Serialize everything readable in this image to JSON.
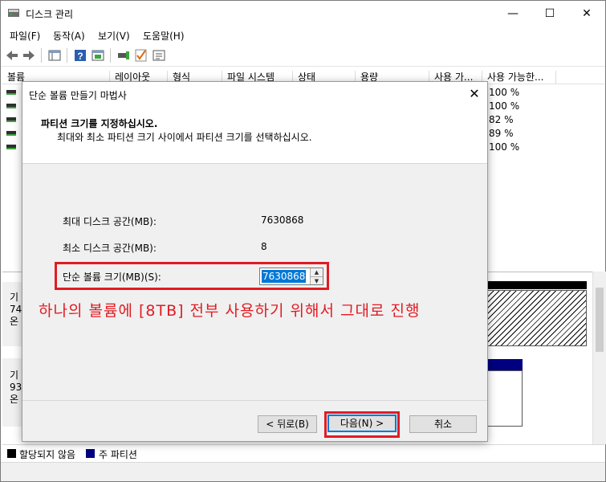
{
  "window": {
    "title": "디스크 관리",
    "minimize": "—",
    "maximize": "☐",
    "close": "✕"
  },
  "menu": [
    "파일(F)",
    "동작(A)",
    "보기(V)",
    "도움말(H)"
  ],
  "toolbar_icons": [
    "back-arrow-icon",
    "forward-arrow-icon",
    "console-tree-icon",
    "help-icon",
    "properties-icon",
    "connect-icon",
    "check-icon",
    "settings-icon"
  ],
  "list": {
    "columns": [
      "볼륨",
      "레이아웃",
      "형식",
      "파일 시스템",
      "상태",
      "용량",
      "사용 가...",
      "사용 가능한..."
    ],
    "rows": [
      "100 %",
      "100 %",
      "82 %",
      "89 %",
      "100 %"
    ]
  },
  "disks": [
    {
      "lines": [
        "기",
        "74",
        "온"
      ]
    },
    {
      "lines": [
        "기",
        "93",
        "온"
      ]
    }
  ],
  "legend": {
    "unallocated": "할당되지 않음",
    "primary": "주 파티션",
    "unallocated_color": "#000000",
    "primary_color": "#000080"
  },
  "dialog": {
    "title": "단순 볼륨 만들기 마법사",
    "close": "✕",
    "heading": "파티션 크기를 지정하십시오.",
    "subheading": "최대와 최소 파티션 크기 사이에서 파티션 크기를 선택하십시오.",
    "max_label": "최대 디스크 공간(MB):",
    "max_value": "7630868",
    "min_label": "최소 디스크 공간(MB):",
    "min_value": "8",
    "size_label": "단순 볼륨 크기(MB)(S):",
    "size_value": "7630868",
    "annotation": "하나의 볼륨에 [8TB] 전부 사용하기 위해서 그대로 진행",
    "back": "< 뒤로(B)",
    "next": "다음(N) >",
    "cancel": "취소"
  },
  "colors": {
    "highlight": "#e11b22",
    "selection": "#0078d7"
  }
}
